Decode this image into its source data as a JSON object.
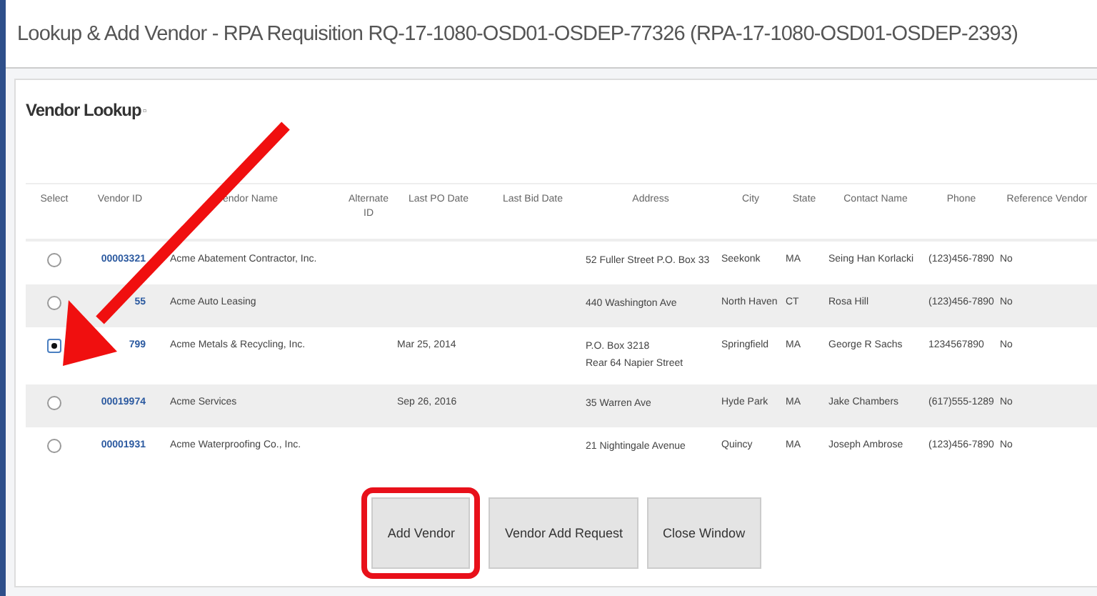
{
  "window": {
    "title": "Lookup & Add Vendor - RPA Requisition RQ-17-1080-OSD01-OSDEP-77326 (RPA-17-1080-OSD01-OSDEP-2393)"
  },
  "section": {
    "title": "Vendor Lookup",
    "collapse_icon": "▫"
  },
  "table": {
    "columns": [
      "Select",
      "Vendor ID",
      "endor Name",
      "Alternate ID",
      "Last PO Date",
      "Last Bid Date",
      "Address",
      "City",
      "State",
      "Contact Name",
      "Phone",
      "Reference Vendor"
    ],
    "rows": [
      {
        "selected": false,
        "vendor_id": "00003321",
        "vendor_name": "Acme Abatement Contractor, Inc.",
        "alternate_id": "",
        "last_po_date": "",
        "last_bid_date": "",
        "address": [
          "52 Fuller Street P.O. Box 33"
        ],
        "city": "Seekonk",
        "state": "MA",
        "contact": "Seing Han Korlacki",
        "phone": "(123)456-7890",
        "reference": "No"
      },
      {
        "selected": false,
        "vendor_id": "55",
        "vendor_name": "Acme Auto Leasing",
        "alternate_id": "",
        "last_po_date": "",
        "last_bid_date": "",
        "address": [
          "440 Washington Ave"
        ],
        "city": "North Haven",
        "state": "CT",
        "contact": "Rosa Hill",
        "phone": "(123)456-7890",
        "reference": "No"
      },
      {
        "selected": true,
        "vendor_id": "799",
        "vendor_name": "Acme Metals & Recycling, Inc.",
        "alternate_id": "",
        "last_po_date": "Mar 25, 2014",
        "last_bid_date": "",
        "address": [
          "P.O. Box 3218",
          "Rear 64 Napier Street"
        ],
        "city": "Springfield",
        "state": "MA",
        "contact": "George R Sachs",
        "phone": "1234567890",
        "reference": "No"
      },
      {
        "selected": false,
        "vendor_id": "00019974",
        "vendor_name": "Acme Services",
        "alternate_id": "",
        "last_po_date": "Sep 26, 2016",
        "last_bid_date": "",
        "address": [
          "35 Warren Ave"
        ],
        "city": "Hyde Park",
        "state": "MA",
        "contact": "Jake Chambers",
        "phone": "(617)555-1289",
        "reference": "No"
      },
      {
        "selected": false,
        "vendor_id": "00001931",
        "vendor_name": "Acme Waterproofing Co., Inc.",
        "alternate_id": "",
        "last_po_date": "",
        "last_bid_date": "",
        "address": [
          "21 Nightingale Avenue"
        ],
        "city": "Quincy",
        "state": "MA",
        "contact": "Joseph Ambrose",
        "phone": "(123)456-7890",
        "reference": "No"
      }
    ]
  },
  "buttons": [
    {
      "label": "Add Vendor",
      "highlighted": true
    },
    {
      "label": "Vendor Add Request",
      "highlighted": false
    },
    {
      "label": "Close Window",
      "highlighted": false
    }
  ]
}
